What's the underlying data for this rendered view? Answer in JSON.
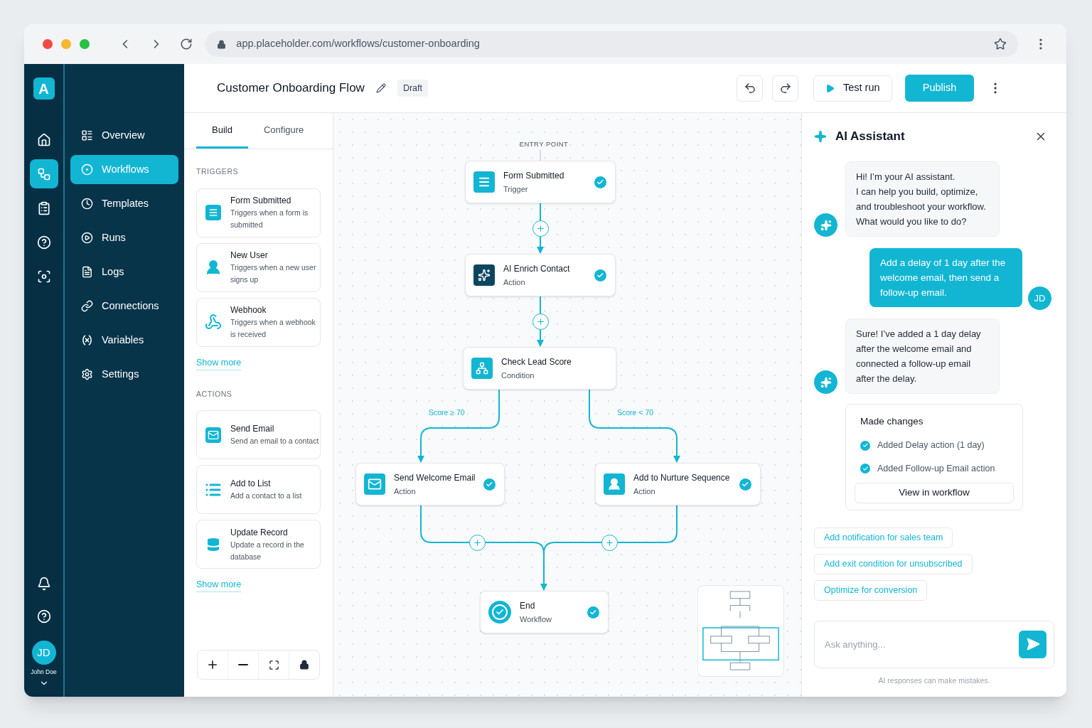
{
  "browser": {
    "url": "app.placeholder.com/workflows/customer-onboarding"
  },
  "rail": {
    "logo": "A",
    "items": [
      {
        "selected": false
      },
      {
        "selected": true
      },
      {
        "selected": false
      },
      {
        "selected": false
      },
      {
        "selected": false
      }
    ],
    "avatar": "JD",
    "user": "John Doe"
  },
  "nav": [
    {
      "label": "Overview",
      "selected": false
    },
    {
      "label": "Workflows",
      "selected": true
    },
    {
      "label": "Templates",
      "selected": false
    },
    {
      "label": "Runs",
      "selected": false
    },
    {
      "label": "Logs",
      "selected": false
    },
    {
      "label": "Connections",
      "selected": false
    },
    {
      "label": "Variables",
      "selected": false
    },
    {
      "label": "Settings",
      "selected": false
    }
  ],
  "header": {
    "title": "Customer Onboarding Flow",
    "badge": "Draft",
    "test_run": "Test run",
    "publish": "Publish"
  },
  "panel": {
    "tabs": [
      {
        "label": "Build",
        "selected": true
      },
      {
        "label": "Configure",
        "selected": false
      }
    ],
    "sections": [
      {
        "heading": "TRIGGERS",
        "more": "Show more",
        "items": [
          {
            "title": "Form Submitted",
            "description": "Triggers when a form is submitted"
          },
          {
            "title": "New User",
            "description": "Triggers when a new user signs up"
          },
          {
            "title": "Webhook",
            "description": "Triggers when a webhook is received"
          }
        ]
      },
      {
        "heading": "ACTIONS",
        "more": "Show more",
        "items": [
          {
            "title": "Send Email",
            "description": "Send an email to a contact"
          },
          {
            "title": "Add to List",
            "description": "Add a contact to a list"
          },
          {
            "title": "Update Record",
            "description": "Update a record in the database"
          }
        ]
      }
    ]
  },
  "canvas": {
    "entry_label": "ENTRY POINT",
    "branches": [
      "Score ≥ 70",
      "Score < 70"
    ],
    "nodes": [
      {
        "title": "Form Submitted",
        "subtitle": "Trigger",
        "done": true
      },
      {
        "title": "AI Enrich Contact",
        "subtitle": "Action",
        "done": true
      },
      {
        "title": "Check Lead Score",
        "subtitle": "Condition",
        "done": false
      },
      {
        "title": "Send Welcome Email",
        "subtitle": "Action",
        "done": true
      },
      {
        "title": "Add to Nurture Sequence",
        "subtitle": "Action",
        "done": true
      },
      {
        "title": "End",
        "subtitle": "Workflow",
        "done": true
      }
    ]
  },
  "assistant": {
    "title": "AI Assistant",
    "messages": [
      {
        "kind": "assistant",
        "text": "Hi! I’m your AI assistant.\nI can help you build, optimize,\nand troubleshoot your workflow.\nWhat would you like to do?"
      },
      {
        "kind": "user",
        "text": "Add a delay of 1 day after the\nwelcome email, then send a\nfollow-up email."
      },
      {
        "kind": "assistant",
        "text": "Sure! I’ve added a 1 day delay\nafter the welcome email and\nconnected a follow-up email\nafter the delay."
      }
    ],
    "user_avatar": "JD",
    "changes": {
      "title": "Made changes",
      "button": "View in workflow",
      "items": [
        {
          "text": "Added Delay action (1 day)",
          "checked": true
        },
        {
          "text": "Added Follow-up Email action",
          "checked": true
        }
      ]
    },
    "suggestions": [
      "Add notification for sales team",
      "Add exit condition for unsubscribed",
      "Optimize for conversion"
    ],
    "input": {
      "placeholder": "Ask anything..."
    },
    "disclaimer": "AI responses can make mistakes."
  }
}
